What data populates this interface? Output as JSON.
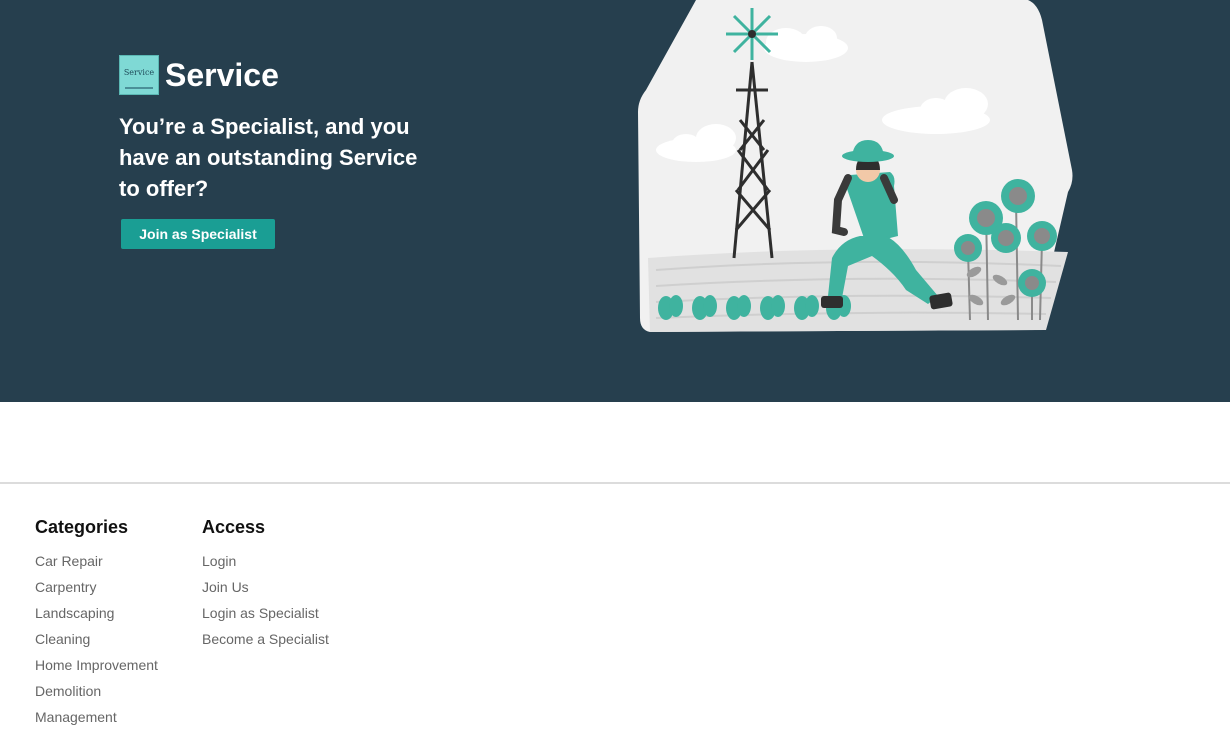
{
  "hero": {
    "logo_text": "Service",
    "brand": "Service",
    "headline": "You’re a Specialist, and you have an outstanding Service to offer?",
    "cta_label": "Join as Specialist"
  },
  "footer": {
    "categories": {
      "title": "Categories",
      "items": [
        "Car Repair",
        "Carpentry",
        "Landscaping",
        "Cleaning",
        "Home Improvement",
        "Demolition",
        "Management"
      ]
    },
    "access": {
      "title": "Access",
      "items": [
        "Login",
        "Join Us",
        "Login as Specialist",
        "Become a Specialist"
      ]
    }
  },
  "colors": {
    "hero_bg": "#263f4e",
    "accent": "#1a9e94",
    "illustration_teal": "#3fb39f"
  },
  "icons": [
    "service-logo-icon",
    "gardener-illustration"
  ]
}
